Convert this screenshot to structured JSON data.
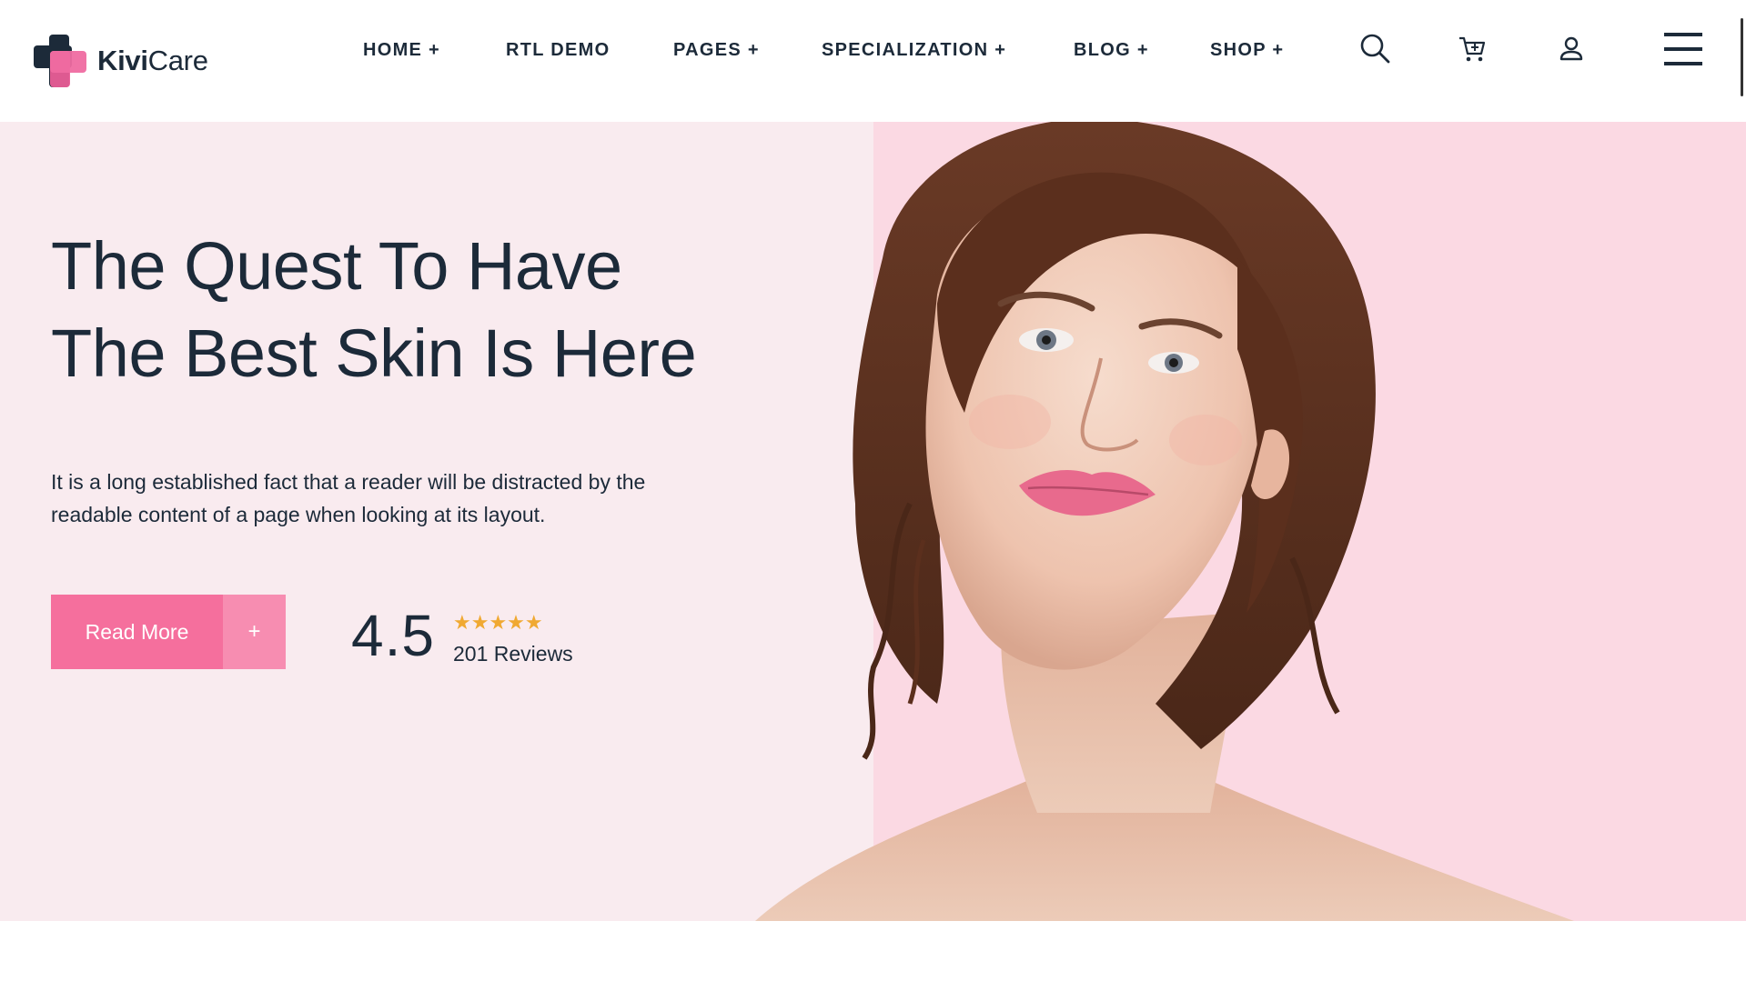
{
  "brand": {
    "name_bold": "Kivi",
    "name_regular": "Care",
    "logo_colors": {
      "dark": "#1c2a39",
      "pink": "#ef6ba1"
    }
  },
  "nav": {
    "items": [
      {
        "label": "HOME +"
      },
      {
        "label": "RTL DEMO"
      },
      {
        "label": "PAGES +"
      },
      {
        "label": "SPECIALIZATION +"
      },
      {
        "label": "BLOG +"
      },
      {
        "label": "SHOP +"
      }
    ],
    "icons": [
      "search-icon",
      "cart-icon",
      "user-icon",
      "menu-icon"
    ]
  },
  "hero": {
    "title_line1": "The Quest To Have",
    "title_line2": "The Best Skin Is Here",
    "description": "It is a long established fact that a reader will be distracted by the readable content of a page when looking at its layout.",
    "button_label": "Read More",
    "button_plus": "+",
    "rating_value": "4.5",
    "stars": "★★★★★",
    "reviews_label": "201 Reviews",
    "image_alt": "portrait-photo"
  },
  "colors": {
    "accent": "#f56f9d",
    "accent_light": "#f78db1",
    "hero_bg": "#f9ebef",
    "hero_bg_right": "#fbd9e3",
    "text": "#1c2a39",
    "star": "#f0a932"
  }
}
